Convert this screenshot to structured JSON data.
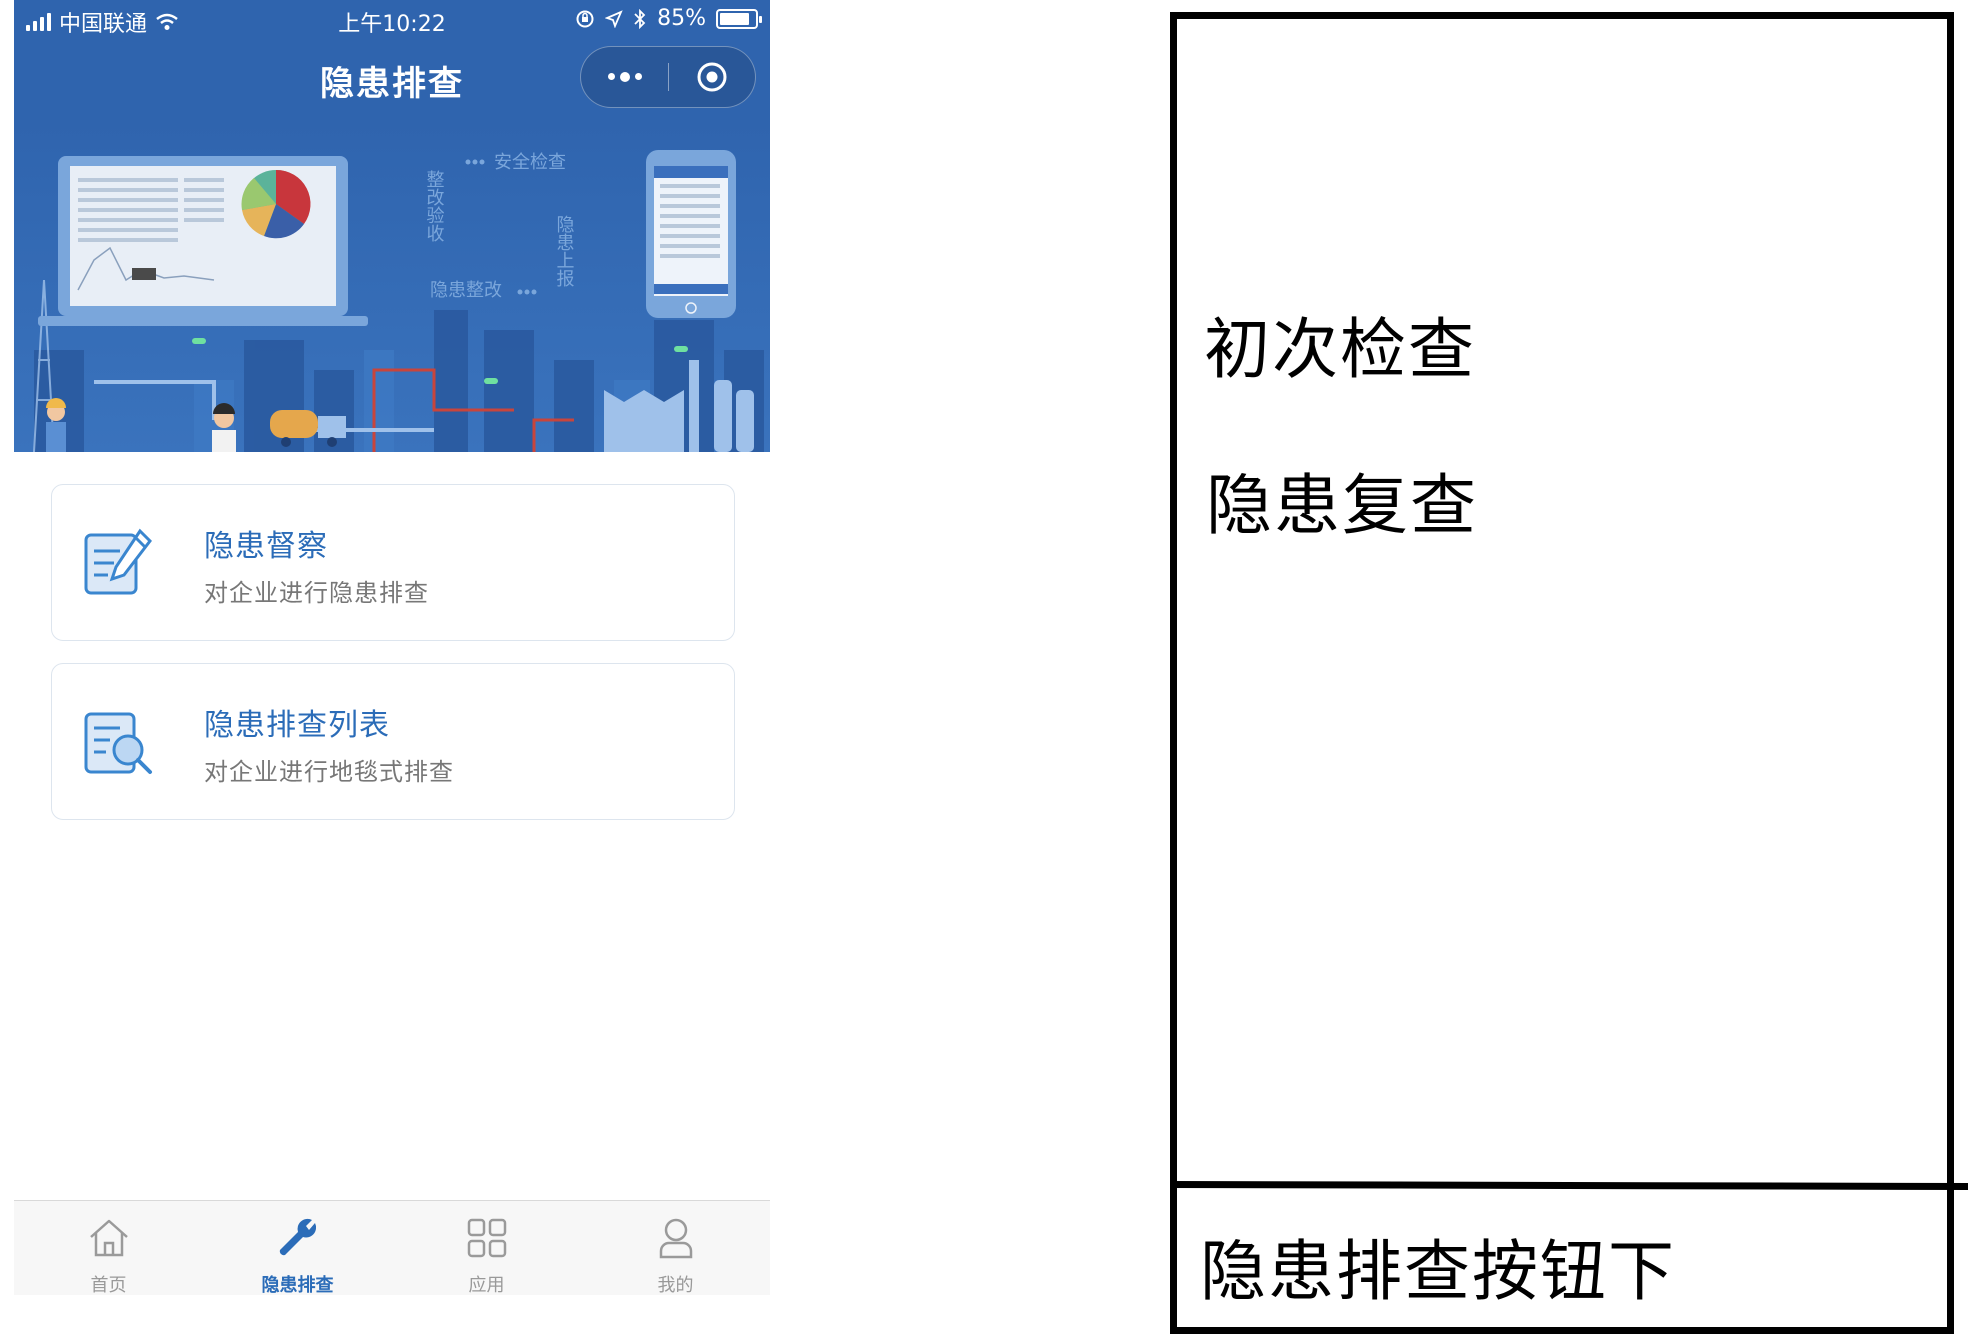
{
  "status_bar": {
    "carrier": "中国联通",
    "time": "上午10:22",
    "battery_text": "85%",
    "battery_level": 0.85
  },
  "nav": {
    "title": "隐患排查",
    "more_icon": "more-dots-icon",
    "close_icon": "target-circle-icon"
  },
  "banner": {
    "labels": [
      "整改验收",
      "安全检查",
      "隐患上报",
      "隐患整改"
    ]
  },
  "cards": [
    {
      "icon": "document-edit-icon",
      "title": "隐患督察",
      "subtitle": "对企业进行隐患排查"
    },
    {
      "icon": "document-search-icon",
      "title": "隐患排查列表",
      "subtitle": "对企业进行地毯式排查"
    }
  ],
  "tabbar": {
    "items": [
      {
        "label": "首页",
        "icon": "home-icon",
        "active": false
      },
      {
        "label": "隐患排查",
        "icon": "wrench-icon",
        "active": true
      },
      {
        "label": "应用",
        "icon": "grid-apps-icon",
        "active": false
      },
      {
        "label": "我的",
        "icon": "user-icon",
        "active": false
      }
    ]
  },
  "sketch": {
    "items": [
      "初次检查",
      "隐患复查"
    ],
    "bottom_label": "隐患排查按钮下"
  },
  "colors": {
    "header_blue": "#2f64ae",
    "accent_blue": "#2b6cb8",
    "card_border": "#dde5ee",
    "muted_text": "#777777",
    "tab_inactive": "#999999"
  }
}
